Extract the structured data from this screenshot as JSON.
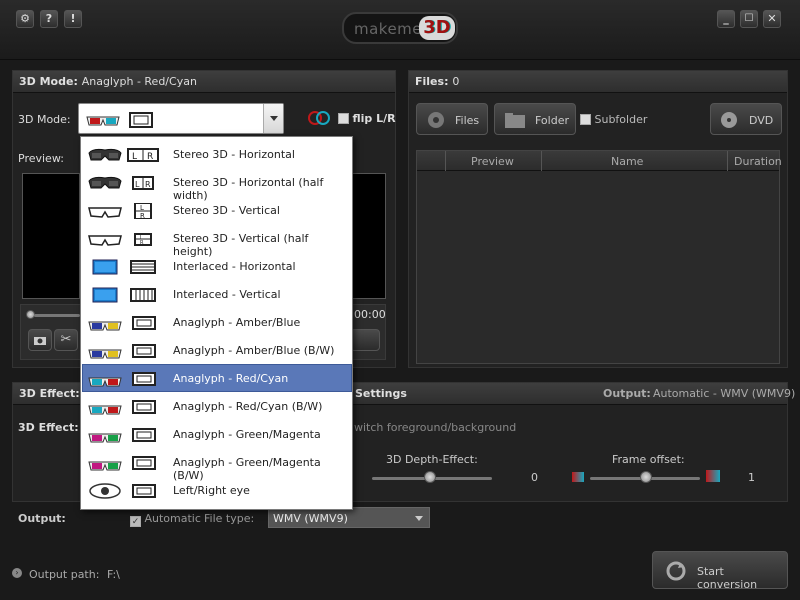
{
  "title": {
    "logo_text": "makeme",
    "logo_badge": "3D"
  },
  "mode_panel": {
    "header_label": "3D Mode:",
    "header_value": "Anaglyph - Red/Cyan",
    "field_label": "3D Mode:",
    "flip_label": "flip L/R",
    "preview_label": "Preview:",
    "time_text": "00:00"
  },
  "dropdown": {
    "items": [
      {
        "label": "Stereo 3D - Horizontal",
        "glasses": "shutter",
        "frame": "LR"
      },
      {
        "label": "Stereo 3D - Horizontal (half width)",
        "glasses": "shutter",
        "frame": "LR-half"
      },
      {
        "label": "Stereo 3D - Vertical",
        "glasses": "polarized",
        "frame": "LR-vertical"
      },
      {
        "label": "Stereo 3D - Vertical (half height)",
        "glasses": "polarized",
        "frame": "LR-vertical-half"
      },
      {
        "label": "Interlaced - Horizontal",
        "glasses": "monitor",
        "frame": "interlaced-h"
      },
      {
        "label": "Interlaced - Vertical",
        "glasses": "monitor",
        "frame": "interlaced-v"
      },
      {
        "label": "Anaglyph - Amber/Blue",
        "glasses": "amber-blue",
        "frame": "film"
      },
      {
        "label": "Anaglyph - Amber/Blue (B/W)",
        "glasses": "amber-blue",
        "frame": "film"
      },
      {
        "label": "Anaglyph - Red/Cyan",
        "glasses": "red-cyan",
        "frame": "film",
        "selected": true
      },
      {
        "label": "Anaglyph - Red/Cyan (B/W)",
        "glasses": "red-cyan",
        "frame": "film"
      },
      {
        "label": "Anaglyph - Green/Magenta",
        "glasses": "green-magenta",
        "frame": "film"
      },
      {
        "label": "Anaglyph - Green/Magenta (B/W)",
        "glasses": "green-magenta",
        "frame": "film"
      },
      {
        "label": "Left/Right eye",
        "glasses": "eye",
        "frame": "film"
      }
    ]
  },
  "files_panel": {
    "header_label": "Files:",
    "header_count": "0",
    "files_button": "Files",
    "folder_button": "Folder",
    "subfolder_label": "Subfolder",
    "dvd_button": "DVD",
    "columns": [
      "Preview",
      "Name",
      "Duration"
    ]
  },
  "effect_panel": {
    "header_label": "3D Effect:",
    "settings_label": "Settings",
    "output_label": "Output:",
    "output_value": "Automatic - WMV (WMV9)",
    "field_label": "3D Effect:",
    "switch_label": "witch foreground/background",
    "depth_label": "3D Depth-Effect:",
    "depth_value": "0",
    "frame_offset_label": "Frame offset:",
    "frame_offset_value": "1"
  },
  "output_row": {
    "label": "Output:",
    "automatic_label": "Automatic",
    "file_type_label": "File type:",
    "file_type_value": "WMV (WMV9)"
  },
  "footer": {
    "output_path_label": "Output path:",
    "output_path_value": "F:\\",
    "start_button": "Start conversion"
  },
  "colors": {
    "selected_bg": "#5a78b8",
    "accent_red": "#c0181a",
    "accent_cyan": "#18a8c0"
  }
}
